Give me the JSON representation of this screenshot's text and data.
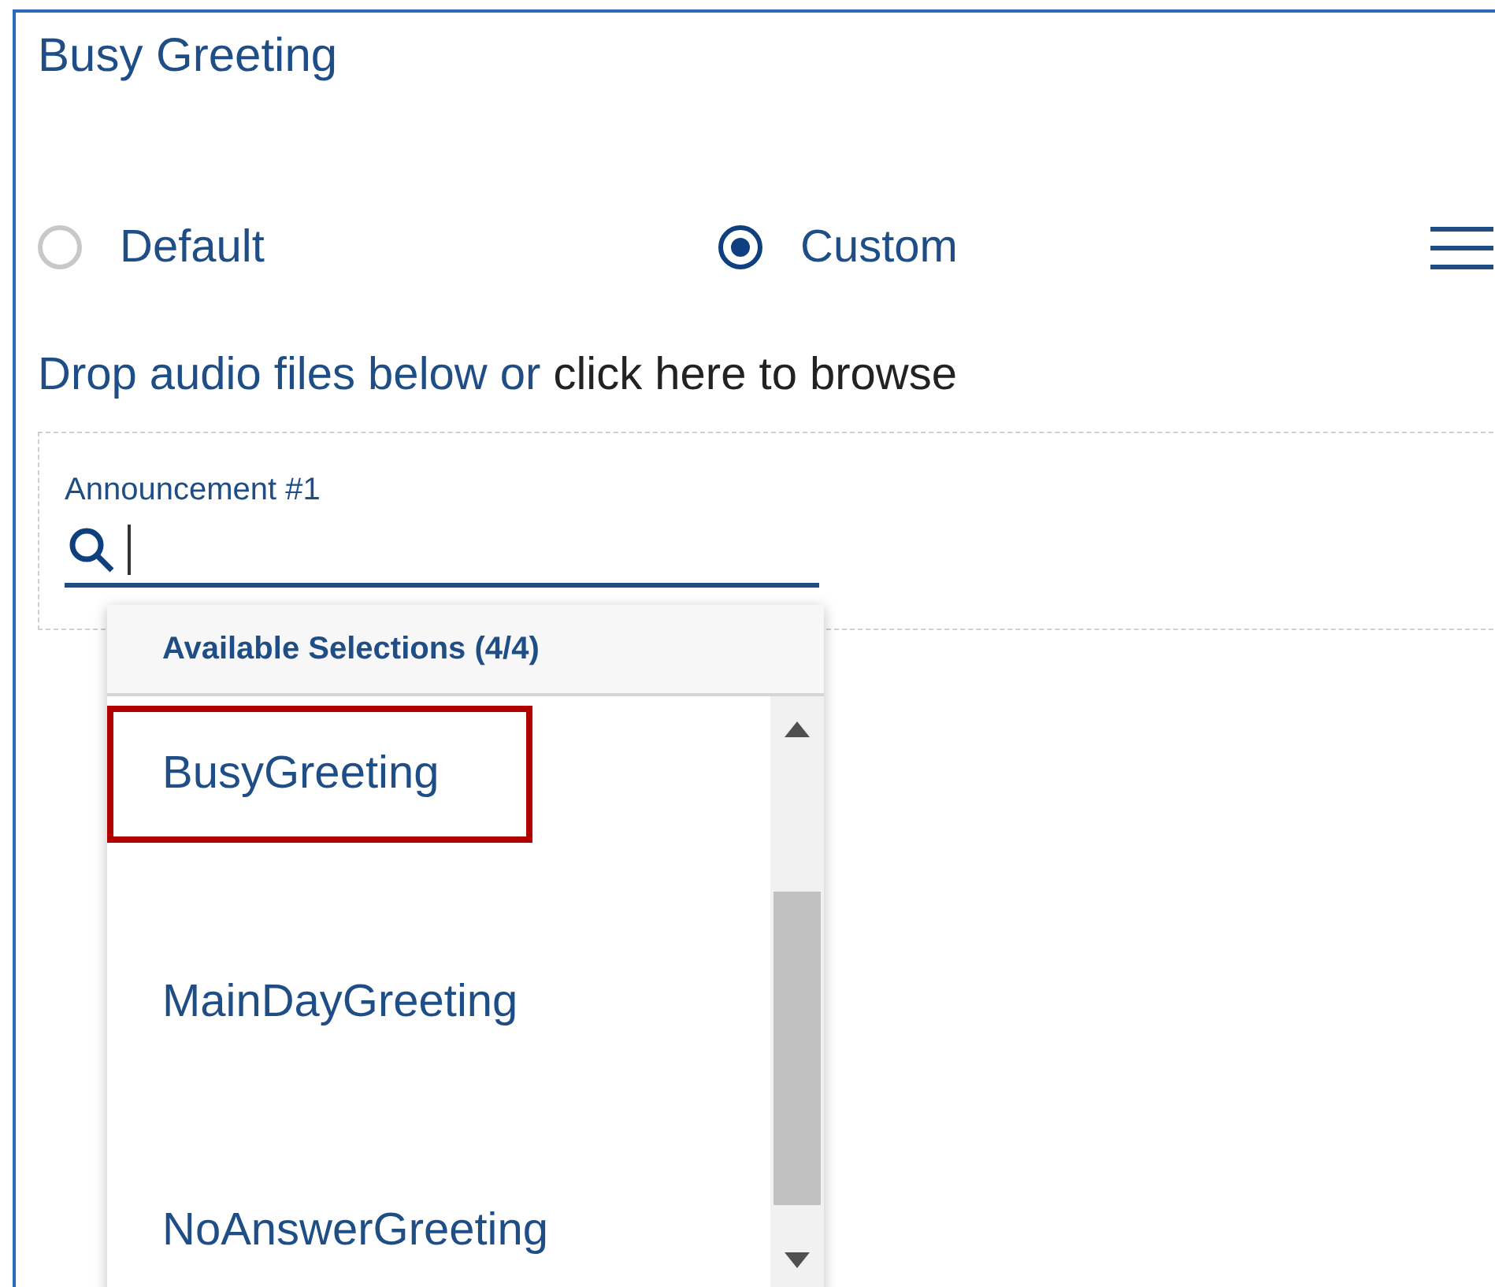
{
  "panel": {
    "title": "Busy Greeting"
  },
  "greeting_options": [
    {
      "label": "Default",
      "selected": false
    },
    {
      "label": "Custom",
      "selected": true
    }
  ],
  "upload_hint": {
    "text": "Drop audio files below or ",
    "link": "click here to browse"
  },
  "announcement": {
    "label": "Announcement #1",
    "focused": true
  },
  "dropdown": {
    "header": "Available Selections (4/4)",
    "items": [
      {
        "label": "BusyGreeting",
        "outlined": true
      },
      {
        "label": "MainDayGreeting",
        "outlined": false
      },
      {
        "label": "NoAnswerGreeting",
        "outlined": false
      }
    ]
  }
}
